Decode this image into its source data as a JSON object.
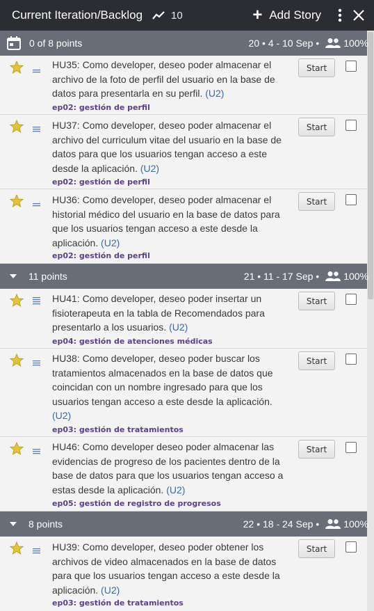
{
  "header": {
    "title": "Current Iteration/Backlog",
    "velocity": "10",
    "add_story_label": "Add Story"
  },
  "iterations": [
    {
      "points": "0 of 8 points",
      "meta": "20 • 4 - 10 Sep •",
      "percent": "100%",
      "stories": [
        {
          "id": "HU35",
          "text": "HU35: Como developer, deseo poder almacenar el archivo de la foto de perfil del usuario en la base de datos para presentarla en su perfil.",
          "label": "(U2)",
          "epic": "ep02: gestión de perfil",
          "start": "Start"
        },
        {
          "id": "HU37",
          "text": "HU37: Como developer, deseo poder almacenar el archivo del curriculum vitae del usuario en la base de datos para que los usuarios tengan acceso a este desde la aplicación.",
          "label": "(U2)",
          "epic": "ep02: gestión de perfil",
          "start": "Start"
        },
        {
          "id": "HU36",
          "text": "HU36: Como developer, deseo poder almacenar el historial médico del usuario en la base de datos para que los usuarios tengan acceso a este desde la aplicación.",
          "label": "(U2)",
          "epic": "ep02: gestión de perfil",
          "start": "Start"
        }
      ]
    },
    {
      "points": "11 points",
      "meta": "21 • 11 - 17 Sep •",
      "percent": "100%",
      "stories": [
        {
          "id": "HU41",
          "text": "HU41: Como developer, deseo poder insertar un fisioterapeuta en la tabla de Recomendados para presentarlo a los usuarios.",
          "label": "(U2)",
          "epic": "ep04: gestión de atenciones médicas",
          "start": "Start"
        },
        {
          "id": "HU38",
          "text": "HU38: Como developer, deseo poder buscar los tratamientos almacenados en la base de datos que coincidan con un nombre ingresado para que los usuarios tengan acceso a este desde la aplicación.",
          "label": "(U2)",
          "epic": "ep03: gestión de tratamientos",
          "start": "Start"
        },
        {
          "id": "HU46",
          "text": "HU46: Como developer deseo poder almacenar las evidencias de progreso de los pacientes dentro de la base de datos para que los usuarios tengan acceso a estas desde la aplicación.",
          "label": "(U2)",
          "epic": "ep05: gestión de registro de progresos",
          "start": "Start"
        }
      ]
    },
    {
      "points": "8 points",
      "meta": "22 • 18 - 24 Sep •",
      "percent": "100%",
      "stories": [
        {
          "id": "HU39",
          "text": "HU39: Como developer, deseo poder obtener los archivos de video almacenados en la base de datos para que los usuarios tengan acceso a este desde la aplicación.",
          "label": "(U2)",
          "epic": "ep03: gestión de tratamientos",
          "start": "Start"
        }
      ]
    }
  ],
  "icons": {
    "velocity": "trend-line-icon",
    "add": "plus-icon",
    "menu": "kebab-menu-icon",
    "close": "close-icon",
    "calendar": "calendar-icon",
    "collapse": "caret-down-icon",
    "people": "people-icon",
    "star": "star-icon",
    "type": "feature-icon"
  },
  "colors": {
    "header_bg": "#2b2d33",
    "iteration_bg": "#686d77",
    "star": "#e4c437",
    "link": "#3b6aa8",
    "epic": "#5e3f8a"
  }
}
